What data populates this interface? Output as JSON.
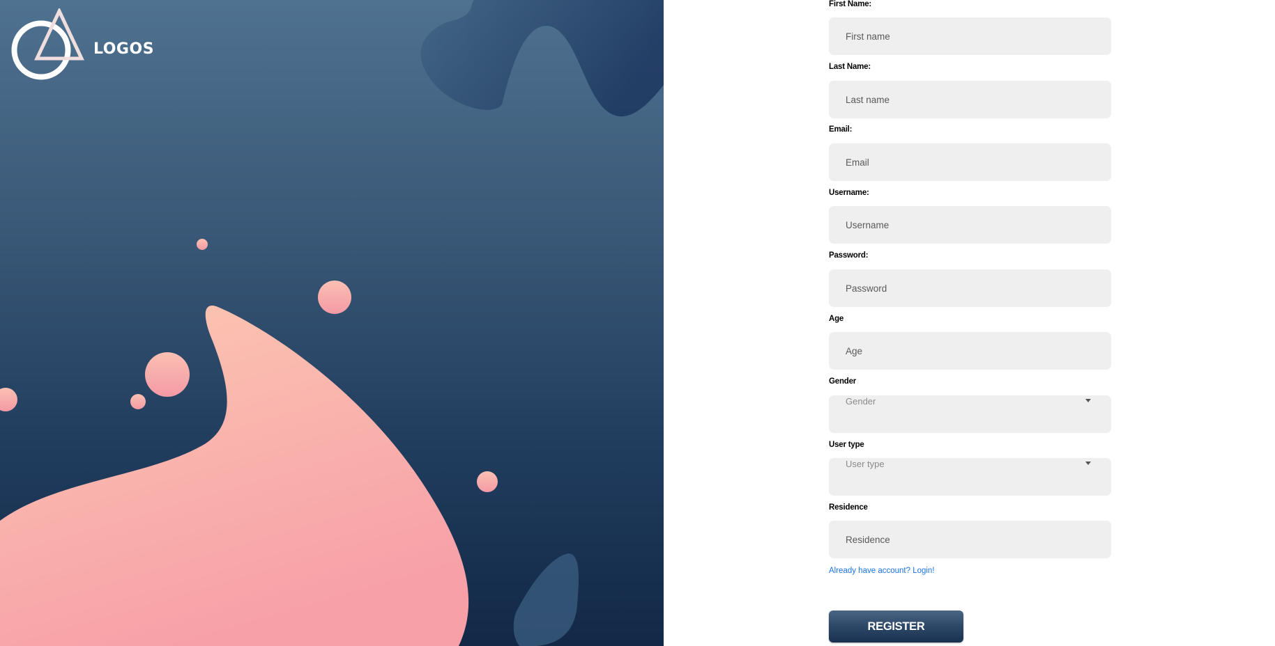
{
  "brand": {
    "name": "LOGOS"
  },
  "form": {
    "fields": [
      {
        "label": "First Name:",
        "placeholder": "First name"
      },
      {
        "label": "Last Name:",
        "placeholder": "Last name"
      },
      {
        "label": "Email:",
        "placeholder": "Email"
      },
      {
        "label": "Username:",
        "placeholder": "Username"
      },
      {
        "label": "Password:",
        "placeholder": "Password"
      },
      {
        "label": "Age",
        "placeholder": "Age"
      },
      {
        "label": "Gender",
        "selected": "Gender"
      },
      {
        "label": "User type",
        "selected": "User type"
      },
      {
        "label": "Residence",
        "placeholder": "Residence"
      }
    ],
    "login_link": "Already have account? Login!",
    "register_label": "REGISTER"
  },
  "colors": {
    "hero_top": "#4f7290",
    "hero_bottom": "#122846",
    "blob_peach": "#fcc5b0",
    "blob_pink": "#f7a2a9",
    "input_bg": "#efefef",
    "link": "#1a73e8",
    "button": "#2d4866"
  },
  "icons": {
    "logo": "circle-triangle-logo",
    "select_caret": "caret-down-icon"
  }
}
